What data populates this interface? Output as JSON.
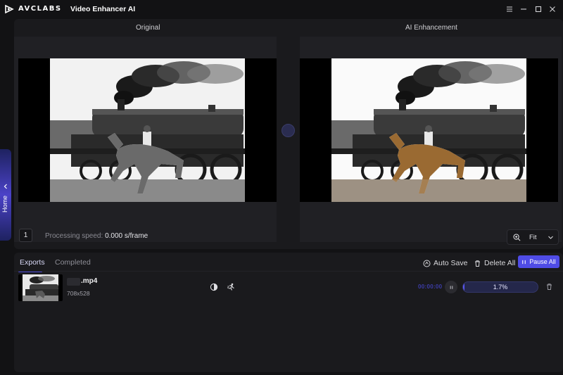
{
  "app": {
    "brand": "AVCLABS",
    "title": "Video Enhancer AI"
  },
  "sidebar": {
    "home_label": "Home"
  },
  "preview": {
    "original_label": "Original",
    "enhanced_label": "AI Enhancement",
    "frame_number": "1",
    "speed_label": "Processing speed:",
    "speed_value": "0.000 s/frame",
    "zoom_label": "Fit"
  },
  "exports": {
    "tabs": [
      {
        "label": "Exports",
        "active": true
      },
      {
        "label": "Completed",
        "active": false
      }
    ],
    "actions": {
      "auto_save": "Auto Save",
      "delete_all": "Delete All",
      "pause_all": "Pause All"
    },
    "items": [
      {
        "filename": ".mp4",
        "resolution": "708x528",
        "elapsed": "00:00:00",
        "progress_label": "1.7%",
        "progress": 0.017
      }
    ]
  },
  "colors": {
    "accent": "#4f4ce6",
    "background": "#121214",
    "panel": "#1a1a1d"
  },
  "icons": [
    "avclabs-logo-icon",
    "menu-icon",
    "minimize-icon",
    "maximize-icon",
    "close-icon",
    "chevron-left-icon",
    "zoom-icon",
    "chevron-down-icon",
    "auto-save-icon",
    "trash-icon",
    "pause-icon",
    "contrast-icon",
    "running-figure-icon"
  ]
}
